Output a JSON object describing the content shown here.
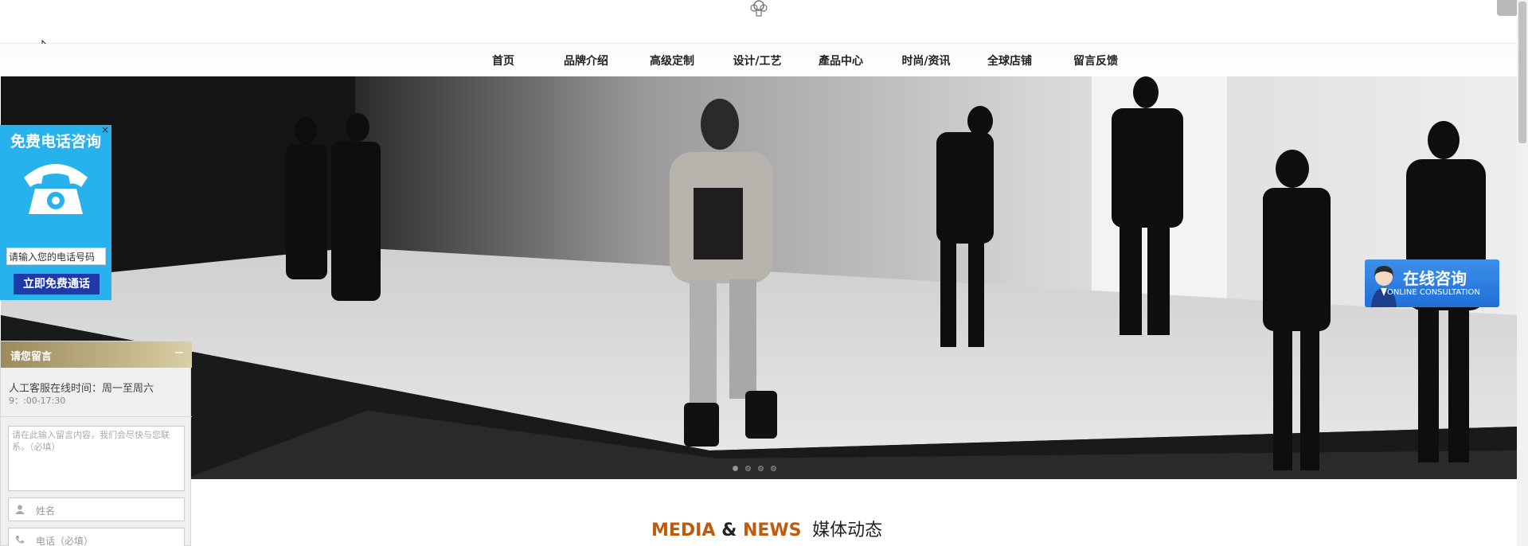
{
  "nav": {
    "items": [
      {
        "label": "首页"
      },
      {
        "label": "品牌介绍"
      },
      {
        "label": "高级定制"
      },
      {
        "label": "设计/工艺"
      },
      {
        "label": "產品中心"
      },
      {
        "label": "时尚/资讯"
      },
      {
        "label": "全球店铺"
      },
      {
        "label": "留言反馈"
      }
    ]
  },
  "phone_widget": {
    "title": "免费电话咨询",
    "close": "×",
    "input_value": "请输入您的电话号码",
    "button": "立即免费通话",
    "color": "#27b2ee"
  },
  "message_widget": {
    "title": "请您留言",
    "minimize": "−",
    "service_hours_label": "人工客服在线时间：周一至周六",
    "service_hours": "9：:00-17:30",
    "textarea_placeholder": "请在此输入留言内容，我们会尽快与您联系。（必填）",
    "name_placeholder": "姓名",
    "phone_placeholder": "电话（必填）"
  },
  "consult": {
    "title": "在线咨询",
    "subtitle": "ONLINE CONSULTATION",
    "color": "#2a7de0"
  },
  "section": {
    "part1": "MEDIA",
    "amp": "&",
    "part2": "NEWS",
    "cn": "媒体动态",
    "accent": "#c25a0a"
  },
  "carousel": {
    "slide_count": 4,
    "active_index": 0
  },
  "icons": [
    "logo-emblem-icon",
    "cursor-icon",
    "phone-icon",
    "user-icon",
    "phone-small-icon",
    "support-avatar-icon"
  ]
}
